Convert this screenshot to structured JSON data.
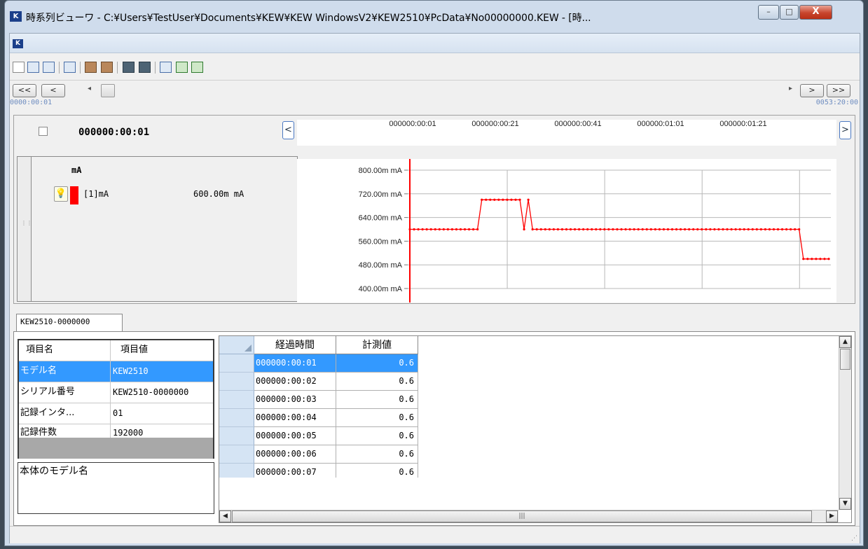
{
  "window": {
    "title": "時系列ビューワ - C:¥Users¥TestUser¥Documents¥KEW¥KEW WindowsV2¥KEW2510¥PcData¥No00000000.KEW - [時...",
    "minimize": "–",
    "maximize": "□",
    "close": "X",
    "app_icon_text": "K"
  },
  "nav": {
    "first": "<<",
    "prev": "<",
    "next": ">",
    "last": ">>",
    "start_time": "0000:00:01",
    "end_time": "0053:20:00"
  },
  "graph": {
    "current_time": "000000:00:01",
    "time_ticks": [
      "000000:00:01",
      "000000:00:21",
      "000000:00:41",
      "000000:01:01",
      "000000:01:21"
    ],
    "scroll_left": "<",
    "scroll_right": ">",
    "legend": {
      "unit_header": "mA",
      "channel_label": "[1]mA",
      "channel_value": "600.00m mA",
      "channel_color": "#ff0000"
    }
  },
  "chart_data": {
    "type": "line",
    "title": "",
    "xlabel": "",
    "ylabel": "",
    "y_tick_labels": [
      "800.00m mA",
      "720.00m mA",
      "640.00m mA",
      "560.00m mA",
      "480.00m mA",
      "400.00m mA"
    ],
    "ylim": [
      400,
      800
    ],
    "grid": true,
    "series": [
      {
        "name": "[1]mA",
        "color": "#ff0000",
        "x": [
          1,
          2,
          3,
          4,
          5,
          6,
          7,
          8,
          9,
          10,
          11,
          12,
          13,
          14,
          15,
          16,
          17,
          18,
          19,
          20,
          21,
          22,
          23,
          24,
          25,
          26,
          27,
          28,
          29,
          30,
          31,
          32,
          33,
          34,
          35,
          36,
          37,
          38,
          39,
          40,
          41,
          42,
          43,
          44,
          45,
          46,
          47,
          48,
          49,
          50,
          51,
          52,
          53,
          54,
          55,
          56,
          57,
          58,
          59,
          60,
          61,
          62,
          63,
          64,
          65,
          66,
          67,
          68,
          69,
          70,
          71,
          72,
          73,
          74,
          75,
          76,
          77,
          78,
          79,
          80,
          81,
          82,
          83,
          84,
          85,
          86,
          87,
          88,
          89,
          90,
          91,
          92,
          93,
          94,
          95,
          96,
          97,
          98,
          99,
          100
        ],
        "values": [
          600,
          600,
          600,
          600,
          600,
          600,
          600,
          600,
          600,
          600,
          600,
          600,
          600,
          600,
          600,
          600,
          600,
          700,
          700,
          700,
          700,
          700,
          700,
          700,
          700,
          700,
          700,
          600,
          700,
          600,
          600,
          600,
          600,
          600,
          600,
          600,
          600,
          600,
          600,
          600,
          600,
          600,
          600,
          600,
          600,
          600,
          600,
          600,
          600,
          600,
          600,
          600,
          600,
          600,
          600,
          600,
          600,
          600,
          600,
          600,
          600,
          600,
          600,
          600,
          600,
          600,
          600,
          600,
          600,
          600,
          600,
          600,
          600,
          600,
          600,
          600,
          600,
          600,
          600,
          600,
          600,
          600,
          600,
          600,
          600,
          600,
          600,
          600,
          600,
          600,
          600,
          600,
          600,
          500,
          500,
          500,
          500,
          500,
          500,
          500
        ]
      }
    ]
  },
  "tab": {
    "label": "KEW2510-0000000"
  },
  "properties": {
    "headers": [
      "項目名",
      "項目値"
    ],
    "rows": [
      {
        "name": "モデル名",
        "value": "KEW2510"
      },
      {
        "name": "シリアル番号",
        "value": "KEW2510-0000000"
      },
      {
        "name": "記録インタ...",
        "value": "01"
      },
      {
        "name": "記録件数",
        "value": "192000"
      }
    ],
    "description": "本体のモデル名"
  },
  "data_grid": {
    "headers": [
      "経過時間",
      "計測値"
    ],
    "rows": [
      {
        "time": "000000:00:01",
        "value": "0.6"
      },
      {
        "time": "000000:00:02",
        "value": "0.6"
      },
      {
        "time": "000000:00:03",
        "value": "0.6"
      },
      {
        "time": "000000:00:04",
        "value": "0.6"
      },
      {
        "time": "000000:00:05",
        "value": "0.6"
      },
      {
        "time": "000000:00:06",
        "value": "0.6"
      },
      {
        "time": "000000:00:07",
        "value": "0.6"
      }
    ],
    "hscroll_grip": "|||"
  }
}
